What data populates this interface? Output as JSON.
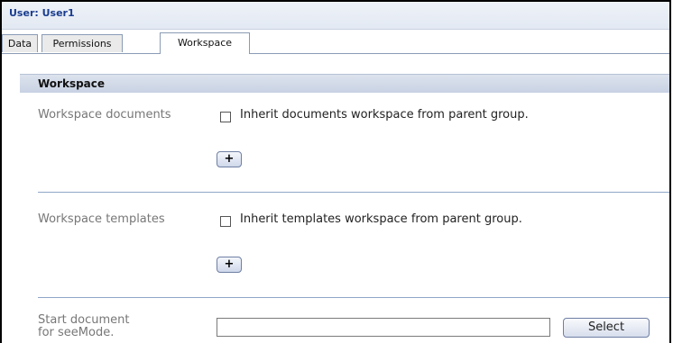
{
  "header": {
    "title": "User: User1"
  },
  "tabs": [
    {
      "label": "Data",
      "active": false
    },
    {
      "label": "Permissions",
      "active": false
    },
    {
      "label": "Workspace",
      "active": true
    }
  ],
  "section": {
    "title": "Workspace"
  },
  "workspace_documents": {
    "label": "Workspace documents",
    "checkbox_label": "Inherit documents workspace from parent group.",
    "checked": false,
    "add_label": "+"
  },
  "workspace_templates": {
    "label": "Workspace templates",
    "checkbox_label": "Inherit templates workspace from parent group.",
    "checked": false,
    "add_label": "+"
  },
  "start_document": {
    "label_line1": "Start document",
    "label_line2": "for seeMode.",
    "value": "",
    "select_label": "Select"
  },
  "colors": {
    "header_title": "#1a3d8f",
    "divider": "#8fa5c8",
    "section_header_bg": "#c8d2e3"
  }
}
